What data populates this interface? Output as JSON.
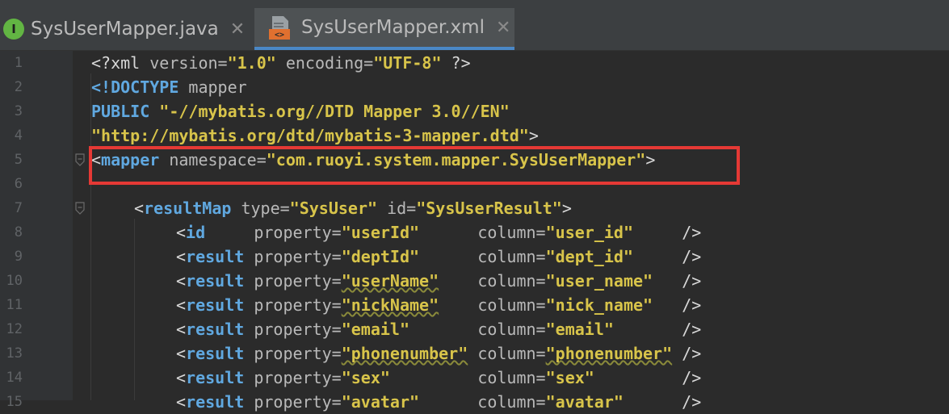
{
  "tabs": [
    {
      "label": "SysUserMapper.java",
      "icon": "java-interface-icon"
    },
    {
      "label": "SysUserMapper.xml",
      "icon": "xml-file-icon",
      "active": true
    }
  ],
  "gutter": {
    "line_numbers": [
      "1",
      "2",
      "3",
      "4",
      "5",
      "6",
      "7",
      "8",
      "9",
      "10",
      "11",
      "12",
      "13",
      "14",
      "15"
    ]
  },
  "code": {
    "l1": {
      "open": "<?xml ",
      "a1": "version=",
      "v1": "\"1.0\"",
      "a2": " encoding=",
      "v2": "\"UTF-8\"",
      "close": " ?>"
    },
    "l2": {
      "open": "<!DOCTYPE",
      "rest": " mapper"
    },
    "l3": {
      "kw": "PUBLIC",
      "str": " \"-//mybatis.org//DTD Mapper 3.0//EN\""
    },
    "l4": {
      "str": "\"http://mybatis.org/dtd/mybatis-3-mapper.dtd\"",
      "close": ">"
    },
    "l5": {
      "open": "<",
      "tag": "mapper",
      "a1": " namespace=",
      "v1": "\"com.ruoyi.system.mapper.SysUserMapper\"",
      "close": ">"
    },
    "l7": {
      "open": "<",
      "tag": "resultMap",
      "a1": " type=",
      "v1": "\"SysUser\"",
      "a2": " id=",
      "v2": "\"SysUserResult\"",
      "close": ">"
    },
    "rows": [
      {
        "tag": "id",
        "pad": "    ",
        "prop": "\"userId\"",
        "pad2": "      ",
        "col": "\"user_id\"",
        "pad3": "     "
      },
      {
        "tag": "result",
        "pad": "",
        "prop": "\"deptId\"",
        "pad2": "      ",
        "col": "\"dept_id\"",
        "pad3": "     "
      },
      {
        "tag": "result",
        "pad": "",
        "prop": "\"userName\"",
        "pad2": "    ",
        "col": "\"user_name\"",
        "pad3": "   "
      },
      {
        "tag": "result",
        "pad": "",
        "prop": "\"nickName\"",
        "pad2": "    ",
        "col": "\"nick_name\"",
        "pad3": "   "
      },
      {
        "tag": "result",
        "pad": "",
        "prop": "\"email\"",
        "pad2": "       ",
        "col": "\"email\"",
        "pad3": "       "
      },
      {
        "tag": "result",
        "pad": "",
        "prop": "\"phonenumber\"",
        "pad2": " ",
        "col": "\"phonenumber\"",
        "pad3": " "
      },
      {
        "tag": "result",
        "pad": "",
        "prop": "\"sex\"",
        "pad2": "         ",
        "col": "\"sex\"",
        "pad3": "         "
      },
      {
        "tag": "result",
        "pad": "",
        "prop": "\"avatar\"",
        "pad2": "      ",
        "col": "\"avatar\"",
        "pad3": "      "
      }
    ],
    "attr_property": " property=",
    "attr_column": "column=",
    "self_close": "/>",
    "lt": "<"
  },
  "colors": {
    "highlight_box": "#e53935",
    "background": "#2b2b2b",
    "tab_active": "#4e5254"
  }
}
